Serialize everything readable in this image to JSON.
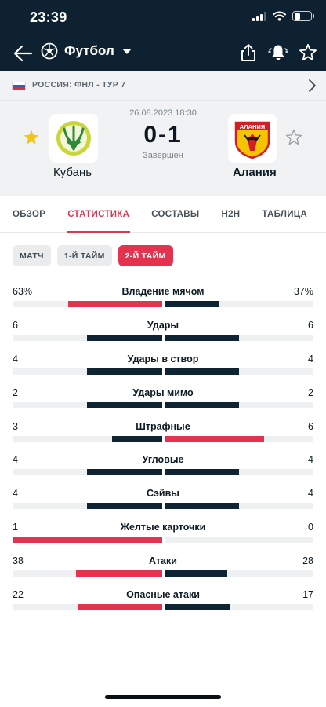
{
  "status_bar": {
    "time": "23:39"
  },
  "nav": {
    "sport_label": "Футбол",
    "icons": [
      "back-arrow-icon",
      "football-icon",
      "chevron-down-icon",
      "share-icon",
      "bell-icon",
      "star-icon"
    ]
  },
  "league": {
    "label": "РОССИЯ: ФНЛ - ТУР 7"
  },
  "match": {
    "date": "26.08.2023 18:30",
    "score": "0-1",
    "state": "Завершен",
    "home": {
      "name": "Кубань",
      "favorite": true
    },
    "away": {
      "name": "Алания",
      "favorite": false,
      "logo_text": "АЛАНИЯ"
    }
  },
  "tabs": [
    "ОБЗОР",
    "СТАТИСТИКА",
    "СОСТАВЫ",
    "H2H",
    "ТАБЛИЦА"
  ],
  "active_tab": 1,
  "segments": [
    "МАТЧ",
    "1-Й ТАЙМ",
    "2-Й ТАЙМ"
  ],
  "active_segment": 2,
  "colors": {
    "accent": "#e3334e",
    "dark": "#0e2130",
    "win": "#e3334e",
    "neutral": "#0f2432",
    "track": "#eef0f2"
  },
  "stats": [
    {
      "name": "Владение мячом",
      "home": "63%",
      "away": "37%",
      "home_value": 63,
      "away_value": 37
    },
    {
      "name": "Удары",
      "home": "6",
      "away": "6",
      "home_value": 6,
      "away_value": 6
    },
    {
      "name": "Удары в створ",
      "home": "4",
      "away": "4",
      "home_value": 4,
      "away_value": 4
    },
    {
      "name": "Удары мимо",
      "home": "2",
      "away": "2",
      "home_value": 2,
      "away_value": 2
    },
    {
      "name": "Штрафные",
      "home": "3",
      "away": "6",
      "home_value": 3,
      "away_value": 6
    },
    {
      "name": "Угловые",
      "home": "4",
      "away": "4",
      "home_value": 4,
      "away_value": 4
    },
    {
      "name": "Сэйвы",
      "home": "4",
      "away": "4",
      "home_value": 4,
      "away_value": 4
    },
    {
      "name": "Желтые карточки",
      "home": "1",
      "away": "0",
      "home_value": 1,
      "away_value": 0
    },
    {
      "name": "Атаки",
      "home": "38",
      "away": "28",
      "home_value": 38,
      "away_value": 28
    },
    {
      "name": "Опасные атаки",
      "home": "22",
      "away": "17",
      "home_value": 22,
      "away_value": 17
    }
  ]
}
